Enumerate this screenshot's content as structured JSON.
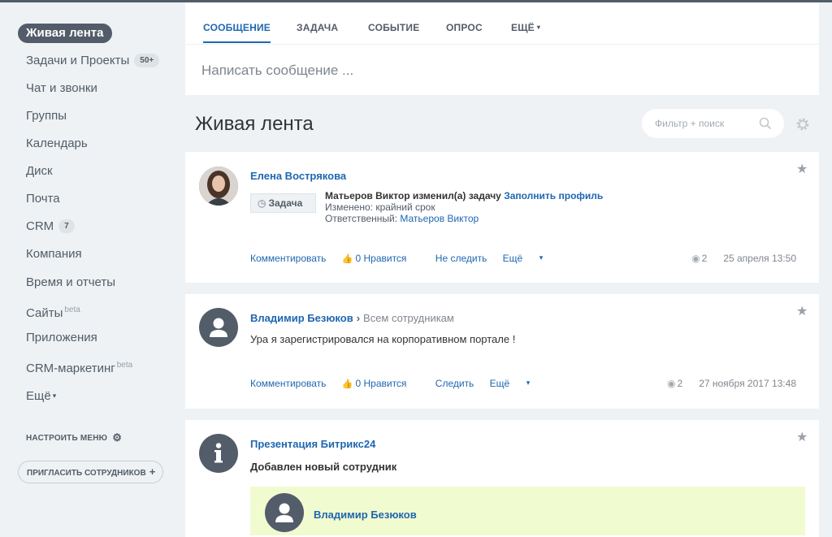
{
  "sidebar": {
    "items": [
      {
        "label": "Живая лента",
        "active": true
      },
      {
        "label": "Задачи и Проекты",
        "counter": "50+"
      },
      {
        "label": "Чат и звонки"
      },
      {
        "label": "Группы"
      },
      {
        "label": "Календарь"
      },
      {
        "label": "Диск"
      },
      {
        "label": "Почта"
      },
      {
        "label": "CRM",
        "counter": "7"
      },
      {
        "label": "Компания"
      },
      {
        "label": "Время и отчеты"
      },
      {
        "label": "Сайты",
        "beta": "beta"
      },
      {
        "label": "Приложения"
      },
      {
        "label": "CRM-маркетинг",
        "beta": "beta"
      },
      {
        "label": "Ещё"
      }
    ],
    "configure_menu": "НАСТРОИТЬ МЕНЮ",
    "invite": "ПРИГЛАСИТЬ СОТРУДНИКОВ"
  },
  "composer": {
    "tabs": [
      "СООБЩЕНИЕ",
      "ЗАДАЧА",
      "СОБЫТИЕ",
      "ОПРОС",
      "ЕЩЁ"
    ],
    "placeholder": "Написать сообщение ..."
  },
  "header": {
    "title": "Живая лента",
    "search_placeholder": "Фильтр + поиск"
  },
  "posts": [
    {
      "author": "Елена Вострякова",
      "badge": "Задача",
      "line1_prefix": "Матьеров Виктор изменил(а) задачу",
      "line1_link": "Заполнить профиль",
      "line2": "Изменено:  крайний срок",
      "line3_label": "Ответственный:",
      "line3_value": "Матьеров Виктор",
      "actions": {
        "comment": "Комментировать",
        "like": "0 Нравится",
        "follow": "Не следить",
        "more": "Ещё"
      },
      "views": "2",
      "date": "25 апреля 13:50"
    },
    {
      "author": "Владимир Безюков",
      "recipient": "Всем сотрудникам",
      "text": "Ура я зарегистрировался на корпоративном портале !",
      "actions": {
        "comment": "Комментировать",
        "like": "0 Нравится",
        "follow": "Следить",
        "more": "Ещё"
      },
      "views": "2",
      "date": "27 ноября 2017 13:48"
    },
    {
      "author": "Презентация Битрикс24",
      "text": "Добавлен новый сотрудник",
      "new_user": "Владимир Безюков"
    }
  ]
}
